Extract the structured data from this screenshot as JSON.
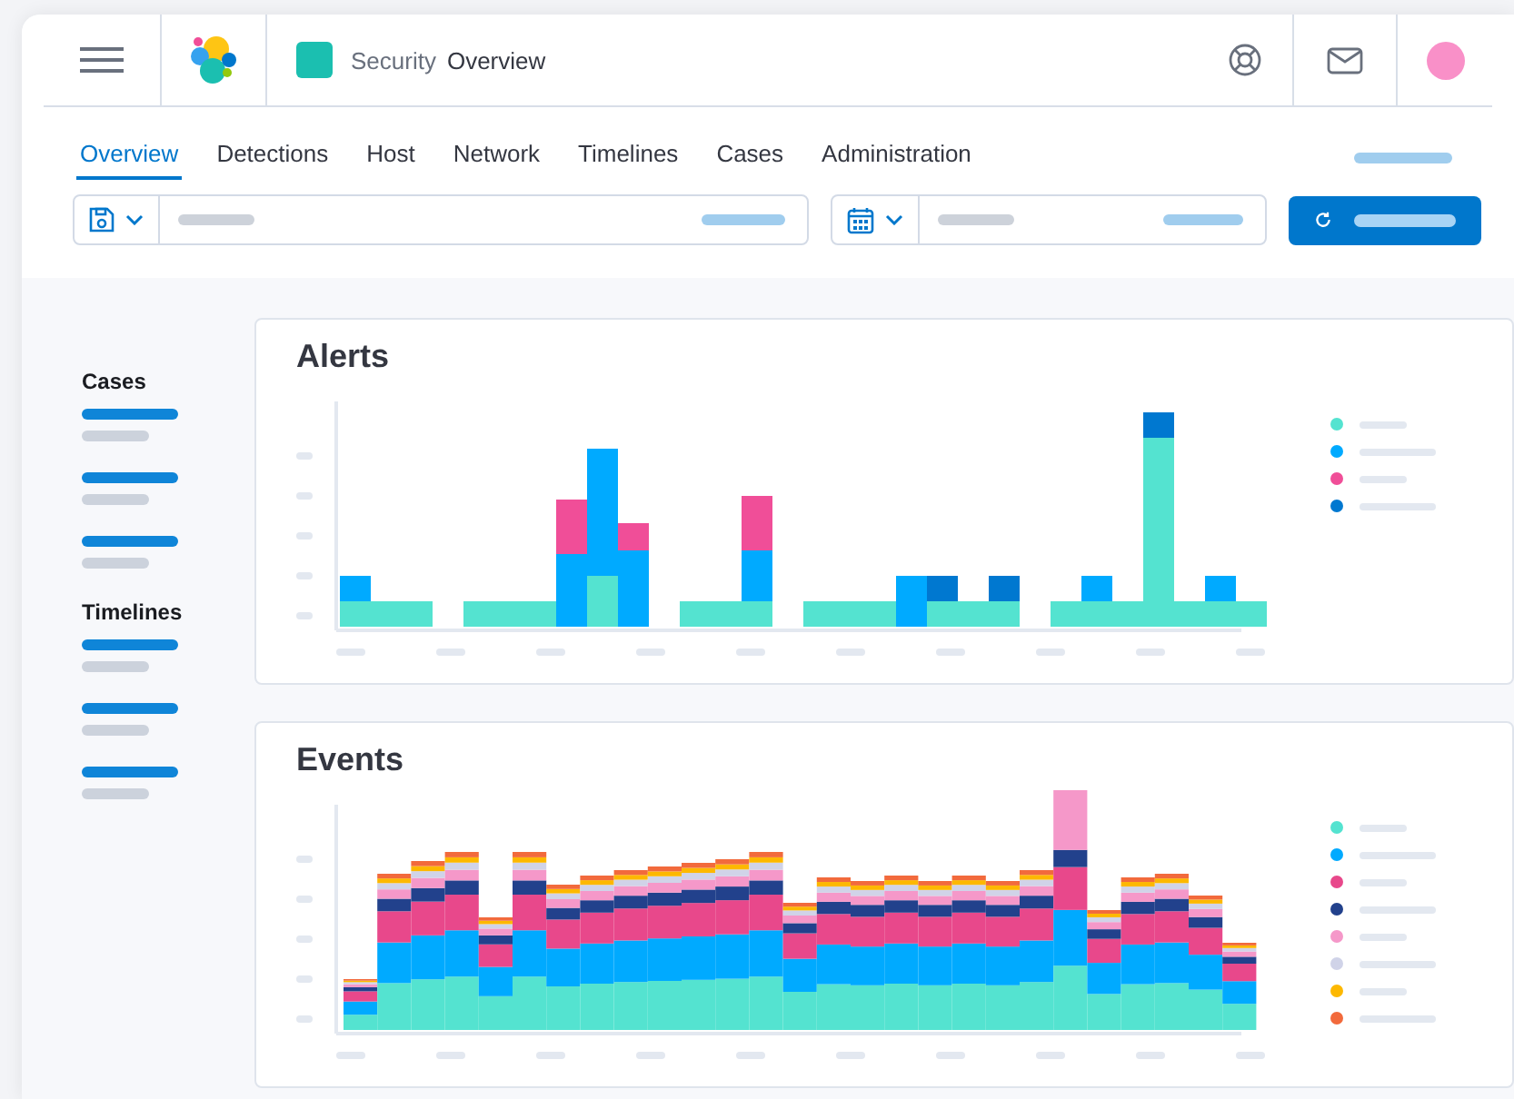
{
  "header": {
    "app": "Security",
    "page": "Overview"
  },
  "tabs": [
    {
      "label": "Overview",
      "selected": true
    },
    {
      "label": "Detections",
      "selected": false
    },
    {
      "label": "Host",
      "selected": false
    },
    {
      "label": "Network",
      "selected": false
    },
    {
      "label": "Timelines",
      "selected": false
    },
    {
      "label": "Cases",
      "selected": false
    },
    {
      "label": "Administration",
      "selected": false
    }
  ],
  "sidebar": {
    "sections": [
      {
        "title": "Cases"
      },
      {
        "title": "Timelines"
      }
    ]
  },
  "panels": [
    {
      "title": "Alerts",
      "kind": "bars",
      "legend": [
        {
          "color": "#54e3d0"
        },
        {
          "color": "#00aaff"
        },
        {
          "color": "#f04e98"
        },
        {
          "color": "#0078d0"
        }
      ]
    },
    {
      "title": "Events",
      "kind": "stacked",
      "legend": [
        {
          "color": "#54e3d0"
        },
        {
          "color": "#00aaff"
        },
        {
          "color": "#e8488b"
        },
        {
          "color": "#22418c"
        },
        {
          "color": "#f598c9"
        },
        {
          "color": "#d0d3e8"
        },
        {
          "color": "#fdb800"
        },
        {
          "color": "#f26a3c"
        }
      ]
    }
  ]
}
